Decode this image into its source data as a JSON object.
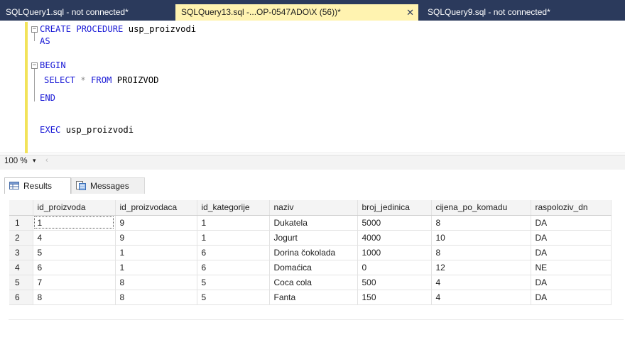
{
  "tabs": [
    {
      "label": "SQLQuery1.sql - not connected*",
      "active": false
    },
    {
      "label": "SQLQuery13.sql -...OP-0547ADO\\X (56))*",
      "active": true,
      "close": "✕"
    },
    {
      "label": "SQLQuery9.sql - not connected*",
      "active": false
    }
  ],
  "code": {
    "line1": {
      "kw": "CREATE PROCEDURE",
      "ident": " usp_proizvodi"
    },
    "line2": {
      "kw": "AS"
    },
    "line3": {
      "kw": "BEGIN"
    },
    "line4": {
      "kw1": "SELECT",
      "op": " * ",
      "kw2": "FROM",
      "ident": " PROIZVOD"
    },
    "line5": {
      "kw": "END"
    },
    "line7": {
      "kw": "EXEC",
      "ident": " usp_proizvodi"
    }
  },
  "zoom": {
    "value": "100 %",
    "arrow": "▾",
    "scroll_left": "‹"
  },
  "result_tabs": {
    "results": "Results",
    "messages": "Messages"
  },
  "grid": {
    "columns": [
      "id_proizvoda",
      "id_proizvodaca",
      "id_kategorije",
      "naziv",
      "broj_jedinica",
      "cijena_po_komadu",
      "raspoloziv_dn"
    ],
    "rows": [
      {
        "num": "1",
        "cells": [
          "1",
          "9",
          "1",
          "Dukatela",
          "5000",
          "8",
          "DA"
        ]
      },
      {
        "num": "2",
        "cells": [
          "4",
          "9",
          "1",
          "Jogurt",
          "4000",
          "10",
          "DA"
        ]
      },
      {
        "num": "3",
        "cells": [
          "5",
          "1",
          "6",
          "Dorina čokolada",
          "1000",
          "8",
          "DA"
        ]
      },
      {
        "num": "4",
        "cells": [
          "6",
          "1",
          "6",
          "Domaćica",
          "0",
          "12",
          "NE"
        ]
      },
      {
        "num": "5",
        "cells": [
          "7",
          "8",
          "5",
          "Coca cola",
          "500",
          "4",
          "DA"
        ]
      },
      {
        "num": "6",
        "cells": [
          "8",
          "8",
          "5",
          "Fanta",
          "150",
          "4",
          "DA"
        ]
      }
    ]
  },
  "colors": {
    "tabstrip": "#2b3a5c",
    "active_tab": "#fff3b0",
    "keyword": "#1a1ad6",
    "gutter_bar": "#f2e35a"
  }
}
